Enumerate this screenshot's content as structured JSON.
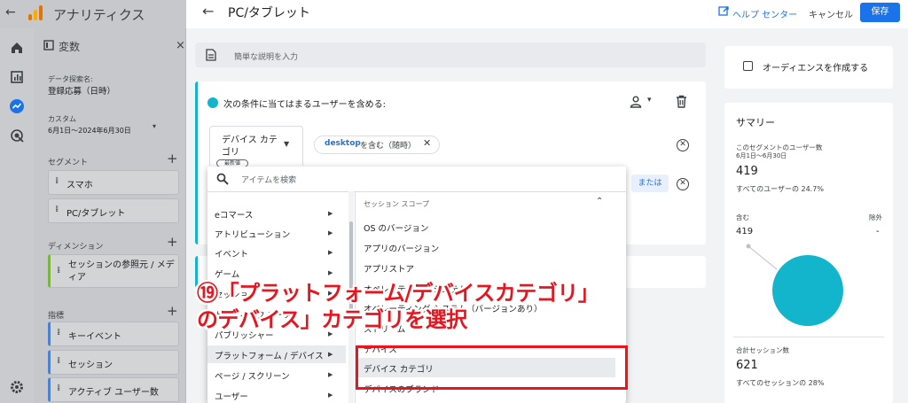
{
  "app": {
    "title": "アナリティクス"
  },
  "variables": {
    "title": "変数",
    "close": "×",
    "dataset_label": "データ探索名:",
    "dataset_value": "登録応募（日時）",
    "date_label": "カスタム",
    "date_value": "6月1日～2024年6月30日",
    "segments_label": "セグメント",
    "segments": [
      "スマホ",
      "PC/タブレット"
    ],
    "dimensions_label": "ディメンション",
    "dimensions": [
      "セッションの参照元 / メディア"
    ],
    "metrics_label": "指標",
    "metrics": [
      "キーイベント",
      "セッション",
      "アクティブ ユーザー数"
    ]
  },
  "header": {
    "segment_name": "PC/タブレット",
    "help": "ヘルプ センター",
    "cancel": "キャンセル",
    "save": "保存"
  },
  "description": {
    "placeholder": "簡単な説明を入力"
  },
  "condition": {
    "title": "次の条件に当てはまるユーザーを含める:",
    "dimension": "デバイス カテゴリ",
    "badge": "最新値",
    "chip_value": "desktop",
    "chip_op": "を含む（随時）",
    "or": "または"
  },
  "dropdown": {
    "search_placeholder": "アイテムを検索",
    "categories": [
      "eコマース",
      "アトリビューション",
      "イベント",
      "ゲーム",
      "セッション",
      "トラフィック ソース",
      "パブリッシャー",
      "プラットフォーム / デバイス",
      "ページ / スクリーン",
      "ユーザー"
    ],
    "selected_category": "プラットフォーム / デバイス",
    "scope_header": "セッション スコープ",
    "items": [
      "OS のバージョン",
      "アプリのバージョン",
      "アプリストア",
      "オペレーティング システム",
      "オペレーティング システム（バージョンあり）",
      "ストリーム",
      "デバイス",
      "デバイス カテゴリ",
      "デバイスのブランド"
    ],
    "selected_item": "デバイス カテゴリ"
  },
  "annotation": {
    "line1": "⑲「プラットフォーム/デバイスカテゴリ」",
    "line2": "のデバイス」カテゴリを選択"
  },
  "audience": {
    "label": "オーディエンスを作成する"
  },
  "summary": {
    "title": "サマリー",
    "users_label": "このセグメントのユーザー数",
    "users_date": "6月1日～6月30日",
    "users_value": "419",
    "users_pct": "すべてのユーザーの 24.7%",
    "include_label": "含む",
    "exclude_label": "除外",
    "include_value": "419",
    "exclude_value": "-",
    "sessions_label": "合計セッション数",
    "sessions_value": "621",
    "sessions_pct": "すべてのセッションの 28%",
    "pie_color": "#12b5cb"
  },
  "colors": {
    "accent": "#1a73e8",
    "teal": "#12b5cb",
    "annotation": "#e8151f"
  },
  "icons": [
    "home-icon",
    "reports-icon",
    "explore-icon",
    "advertising-icon",
    "settings-icon",
    "search-icon",
    "trash-icon",
    "person-icon"
  ]
}
